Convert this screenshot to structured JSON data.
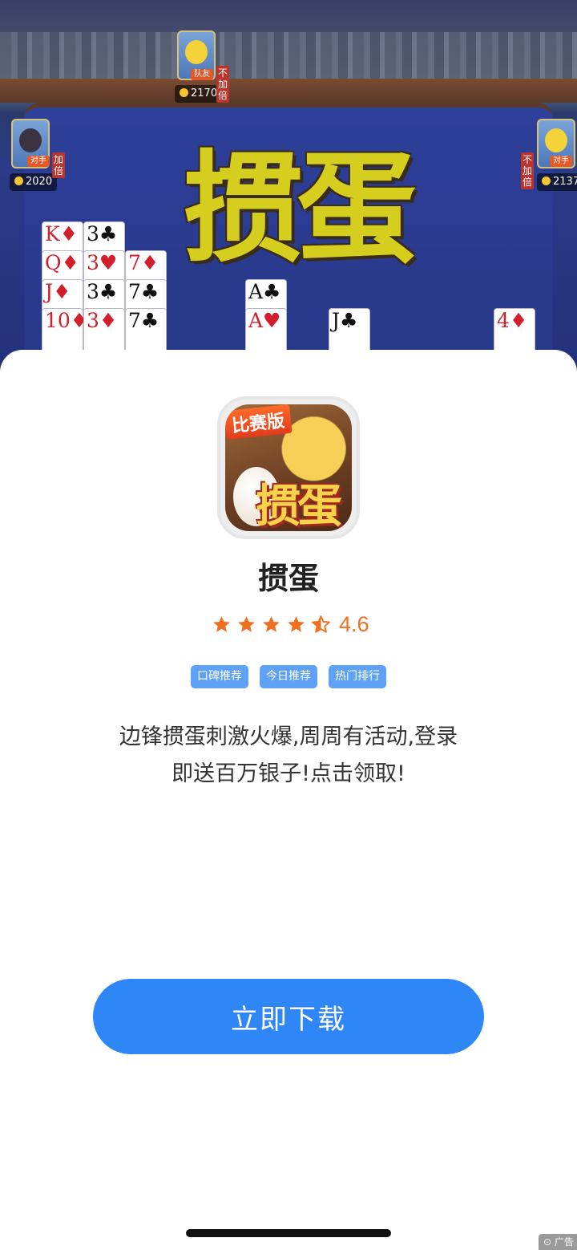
{
  "banner": {
    "big_title": "掼蛋",
    "players": [
      {
        "role": "队友",
        "score": "2170",
        "double": "不加倍"
      },
      {
        "role": "对手",
        "score": "2020",
        "double": "加倍"
      },
      {
        "role": "对手",
        "score": "2137",
        "double": "不加倍"
      }
    ],
    "cards": [
      "K♦",
      "3♣",
      "Q♦",
      "3♥",
      "7♦",
      "J♦",
      "3♣",
      "7♣",
      "10♦",
      "3♦",
      "7♣",
      "A♣",
      "A♥",
      "J♣",
      "4♦"
    ]
  },
  "app": {
    "icon_ribbon": "比赛版",
    "icon_text": "掼蛋",
    "name": "掼蛋",
    "rating": "4.6",
    "rating_value": 4.5,
    "tags": [
      "口碑推荐",
      "今日推荐",
      "热门排行"
    ],
    "description": "边锋掼蛋刺激火爆,周周有活动,登录即送百万银子!点击领取!",
    "download_label": "立即下载"
  },
  "ad_label": "广告",
  "colors": {
    "accent_blue": "#2f86f6",
    "tag_blue": "#5fa2f5",
    "star_orange": "#f0701f"
  }
}
